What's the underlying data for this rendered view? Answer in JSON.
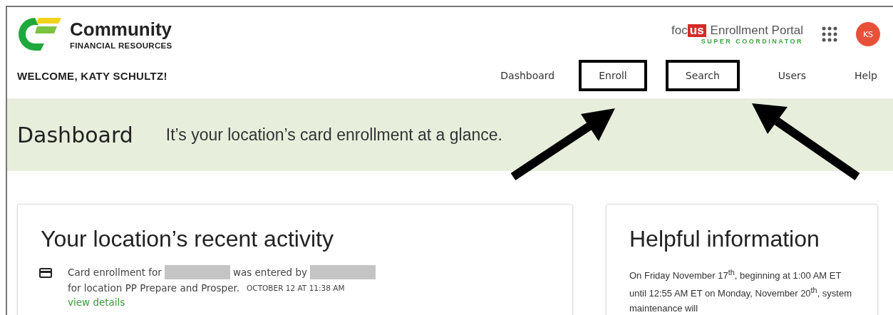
{
  "brand": {
    "name": "Community",
    "subtitle": "FINANCIAL RESOURCES"
  },
  "portal": {
    "prefix": "foc",
    "badge": "us",
    "title": "Enrollment Portal",
    "role": "SUPER COORDINATOR"
  },
  "avatar": {
    "initials": "KS"
  },
  "welcome": "WELCOME, KATY SCHULTZ!",
  "nav": [
    {
      "label": "Dashboard",
      "highlighted": false
    },
    {
      "label": "Enroll",
      "highlighted": true
    },
    {
      "label": "Search",
      "highlighted": true
    },
    {
      "label": "Users",
      "highlighted": false
    },
    {
      "label": "Help",
      "highlighted": false
    }
  ],
  "banner": {
    "title": "Dashboard",
    "tagline": "It’s your location’s card enrollment at a glance."
  },
  "activity": {
    "title": "Your location’s recent activity",
    "items": [
      {
        "parts": [
          {
            "kind": "text",
            "text": "Card enrollment for"
          },
          {
            "kind": "redacted"
          },
          {
            "kind": "text",
            "text": "was entered by"
          },
          {
            "kind": "redacted"
          },
          {
            "kind": "text",
            "text": "for location PP Prepare and Prosper."
          }
        ],
        "time": "OCTOBER 12 AT 11:38 AM",
        "link": "view details"
      }
    ]
  },
  "info": {
    "title": "Helpful information",
    "body": "On Friday November 17$^{th}$, beginning at 1:00 AM ET until 12:55 AM ET on Monday, November 20$^{th}$, system maintenance will"
  }
}
